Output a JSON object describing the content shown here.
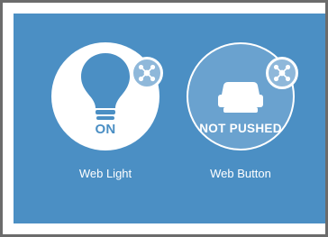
{
  "devices": [
    {
      "name": "Web Light",
      "state": "ON",
      "icon": "lightbulb-icon",
      "status_icon": "network-hub-icon"
    },
    {
      "name": "Web Button",
      "state": "NOT PUSHED",
      "icon": "push-button-icon",
      "status_icon": "network-hub-icon"
    }
  ],
  "colors": {
    "panel": "#4b8fc4",
    "frame": "#6b6b6b",
    "accent": "#4b8fc4",
    "white": "#ffffff"
  }
}
